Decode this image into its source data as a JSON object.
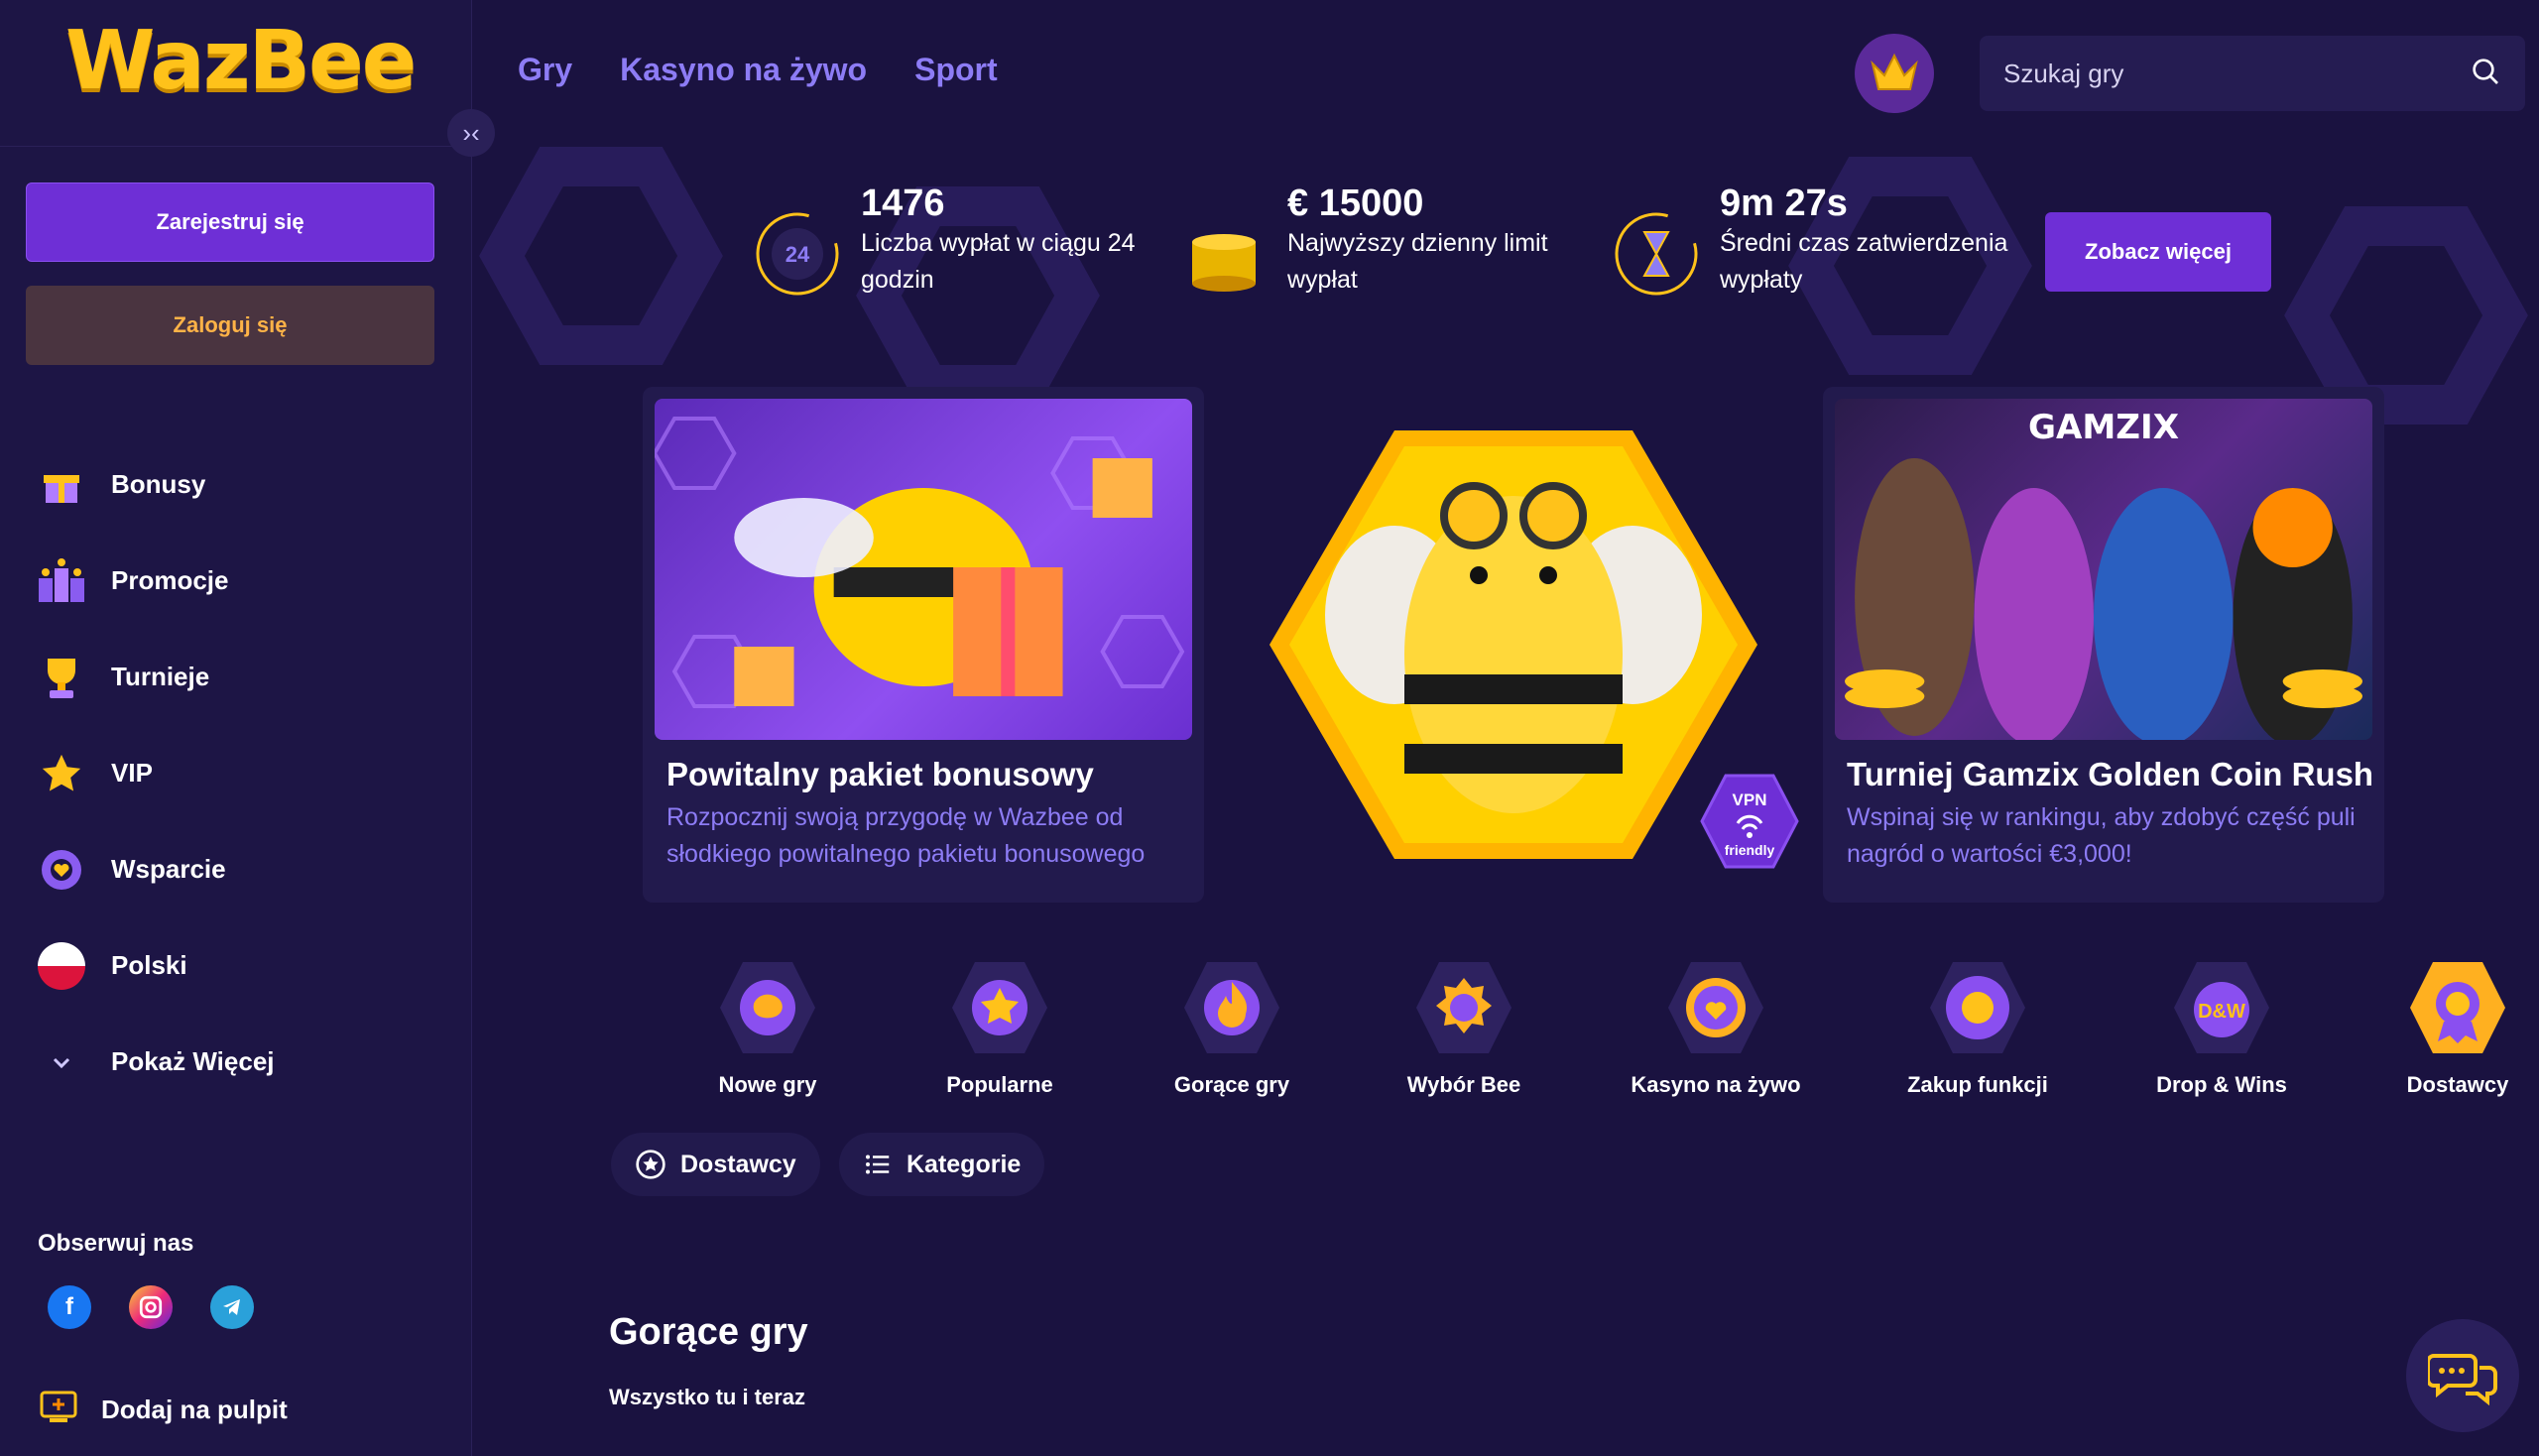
{
  "brand": {
    "logo_text": "WazBee",
    "accent": "#6e2fd6",
    "logo_color": "#ffc21a"
  },
  "sidebar": {
    "register_label": "Zarejestruj się",
    "login_label": "Zaloguj się",
    "items": [
      {
        "label": "Bonusy",
        "icon": "gift-icon"
      },
      {
        "label": "Promocje",
        "icon": "gifts-icon"
      },
      {
        "label": "Turnieje",
        "icon": "trophy-icon"
      },
      {
        "label": "VIP",
        "icon": "star-icon"
      },
      {
        "label": "Wsparcie",
        "icon": "support-icon"
      },
      {
        "label": "Polski",
        "icon": "flag-pl-icon"
      },
      {
        "label": "Pokaż Więcej",
        "icon": "chevron-down-icon"
      }
    ],
    "follow_title": "Obserwuj nas",
    "socials": [
      "facebook-icon",
      "instagram-icon",
      "telegram-icon"
    ],
    "add_to_desktop": "Dodaj na pulpit"
  },
  "header": {
    "nav": [
      "Gry",
      "Kasyno na żywo",
      "Sport"
    ],
    "search_placeholder": "Szukaj gry"
  },
  "stats": [
    {
      "value": "1476",
      "label": "Liczba wypłat w ciągu 24 godzin",
      "icon": "clock-24-icon",
      "icon_text": "24"
    },
    {
      "value": "€ 15000",
      "label": "Najwyższy dzienny limit wypłat",
      "icon": "coin-stack-icon"
    },
    {
      "value": "9m 27s",
      "label": "Średni czas zatwierdzenia wypłaty",
      "icon": "hourglass-icon"
    }
  ],
  "see_more_label": "Zobacz więcej",
  "promos": [
    {
      "title": "Powitalny pakiet bonusowy",
      "desc": "Rozpocznij swoją przygodę w Wazbee od słodkiego powitalnego pakietu bonusowego"
    },
    {
      "title": "Turniej Gamzix Golden Coin Rush",
      "desc": "Wspinaj się w rankingu, aby zdobyć część puli nagród o wartości €3,000!",
      "image_text": "GAMZIX"
    }
  ],
  "mascot_badge": {
    "line1": "VPN",
    "line2": "friendly"
  },
  "categories": [
    {
      "label": "Nowe gry",
      "icon": "new-games-icon"
    },
    {
      "label": "Popularne",
      "icon": "popular-icon"
    },
    {
      "label": "Gorące gry",
      "icon": "flame-icon"
    },
    {
      "label": "Wybór Bee",
      "icon": "bee-choice-icon"
    },
    {
      "label": "Kasyno na żywo",
      "icon": "live-casino-icon"
    },
    {
      "label": "Zakup funkcji",
      "icon": "feature-buy-icon"
    },
    {
      "label": "Drop & Wins",
      "icon": "drop-wins-icon",
      "icon_text": "D&W"
    },
    {
      "label": "Dostawcy",
      "icon": "providers-icon"
    }
  ],
  "filters": [
    {
      "label": "Dostawcy",
      "icon": "star-circle-icon"
    },
    {
      "label": "Kategorie",
      "icon": "list-icon"
    }
  ],
  "section": {
    "title": "Gorące gry",
    "subtitle": "Wszystko tu i teraz"
  }
}
